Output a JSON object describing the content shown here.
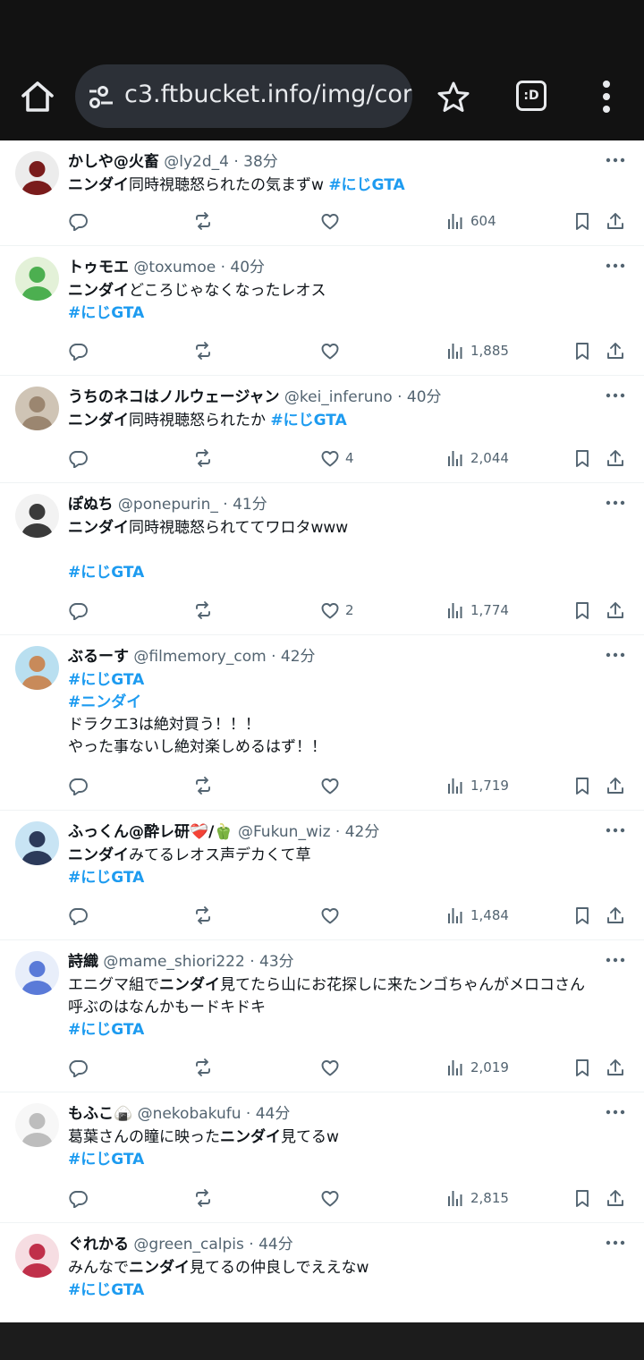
{
  "browser": {
    "url": "c3.ftbucket.info/img/cor",
    "tab_badge": ":D"
  },
  "tweets": [
    {
      "name": "かしや@火畜",
      "handle": "@ly2d_4",
      "time": "38分",
      "lines": [
        [
          {
            "t": "ニンダイ",
            "s": "b"
          },
          {
            "t": "同時視聴怒られたの気まずw "
          },
          {
            "t": "#にじGTA",
            "s": "tag"
          }
        ]
      ],
      "likes": "",
      "views": "604",
      "avatar_color": "#7a1c1c",
      "avatar_bg": "#ececec"
    },
    {
      "name": "トゥモエ",
      "handle": "@toxumoe",
      "time": "40分",
      "lines": [
        [
          {
            "t": "ニンダイ",
            "s": "b"
          },
          {
            "t": "どころじゃなくなったレオス"
          }
        ],
        [
          {
            "t": " #にじGTA",
            "s": "tag"
          }
        ]
      ],
      "likes": "",
      "views": "1,885",
      "avatar_color": "#4caf50",
      "avatar_bg": "#e3f1d8"
    },
    {
      "name": "うちのネコはノルウェージャン",
      "handle": "@kei_inferuno",
      "time": "40分",
      "lines": [
        [
          {
            "t": "ニンダイ",
            "s": "b"
          },
          {
            "t": "同時視聴怒られたか "
          },
          {
            "t": "#にじGTA",
            "s": "tag"
          }
        ]
      ],
      "likes": "4",
      "views": "2,044",
      "avatar_color": "#9b8670",
      "avatar_bg": "#cfc4b5"
    },
    {
      "name": "ぽぬち",
      "handle": "@ponepurin_",
      "time": "41分",
      "lines": [
        [
          {
            "t": "ニンダイ",
            "s": "b"
          },
          {
            "t": "同時視聴怒られててワロタwww"
          }
        ],
        [
          {
            "t": " "
          }
        ],
        [
          {
            "t": "#にじGTA",
            "s": "tag"
          }
        ]
      ],
      "likes": "2",
      "views": "1,774",
      "avatar_color": "#3a3a3a",
      "avatar_bg": "#f2f2f2"
    },
    {
      "name": "ぶるーす",
      "handle": "@filmemory_com",
      "time": "42分",
      "lines": [
        [
          {
            "t": "#にじGTA",
            "s": "tag"
          }
        ],
        [
          {
            "t": "#ニンダイ",
            "s": "tag"
          }
        ],
        [
          {
            "t": "ドラクエ3は絶対買う！！！"
          }
        ],
        [
          {
            "t": "やった事ないし絶対楽しめるはず！！"
          }
        ]
      ],
      "likes": "",
      "views": "1,719",
      "avatar_color": "#c88a5a",
      "avatar_bg": "#b9dff0"
    },
    {
      "name": "ふっくん@酔レ研❤️‍🩹/🫑",
      "handle": "@Fukun_wiz",
      "time": "42分",
      "lines": [
        [
          {
            "t": "ニンダイ",
            "s": "b"
          },
          {
            "t": "みてるレオス声デカくて草"
          }
        ],
        [
          {
            "t": "#にじGTA",
            "s": "tag"
          }
        ]
      ],
      "likes": "",
      "views": "1,484",
      "avatar_color": "#2c3a5a",
      "avatar_bg": "#c8e4f4"
    },
    {
      "name": "詩織",
      "handle": "@mame_shiori222",
      "time": "43分",
      "lines": [
        [
          {
            "t": "エニグマ組で"
          },
          {
            "t": "ニンダイ",
            "s": "b"
          },
          {
            "t": "見てたら山にお花探しに来たンゴちゃんがメロコさん"
          }
        ],
        [
          {
            "t": "呼ぶのはなんかもードキドキ"
          }
        ],
        [
          {
            "t": "#にじGTA",
            "s": "tag"
          }
        ]
      ],
      "likes": "",
      "views": "2,019",
      "avatar_color": "#5a7ad8",
      "avatar_bg": "#e8eefa"
    },
    {
      "name": "もふこ🍙",
      "handle": "@nekobakufu",
      "time": "44分",
      "lines": [
        [
          {
            "t": "葛葉さんの瞳に映った"
          },
          {
            "t": "ニンダイ",
            "s": "b"
          },
          {
            "t": "見てるw"
          }
        ],
        [
          {
            "t": "#にじGTA",
            "s": "tag"
          }
        ]
      ],
      "likes": "",
      "views": "2,815",
      "avatar_color": "#bdbdbd",
      "avatar_bg": "#f7f7f7"
    },
    {
      "name": "ぐれかる",
      "handle": "@green_calpis",
      "time": "44分",
      "lines": [
        [
          {
            "t": "みんなで"
          },
          {
            "t": "ニンダイ",
            "s": "b"
          },
          {
            "t": "見てるの仲良しでええなw"
          }
        ],
        [
          {
            "t": " #にじGTA",
            "s": "tag"
          }
        ]
      ],
      "likes": "",
      "views": "",
      "avatar_color": "#c0304a",
      "avatar_bg": "#f6dde2"
    }
  ]
}
